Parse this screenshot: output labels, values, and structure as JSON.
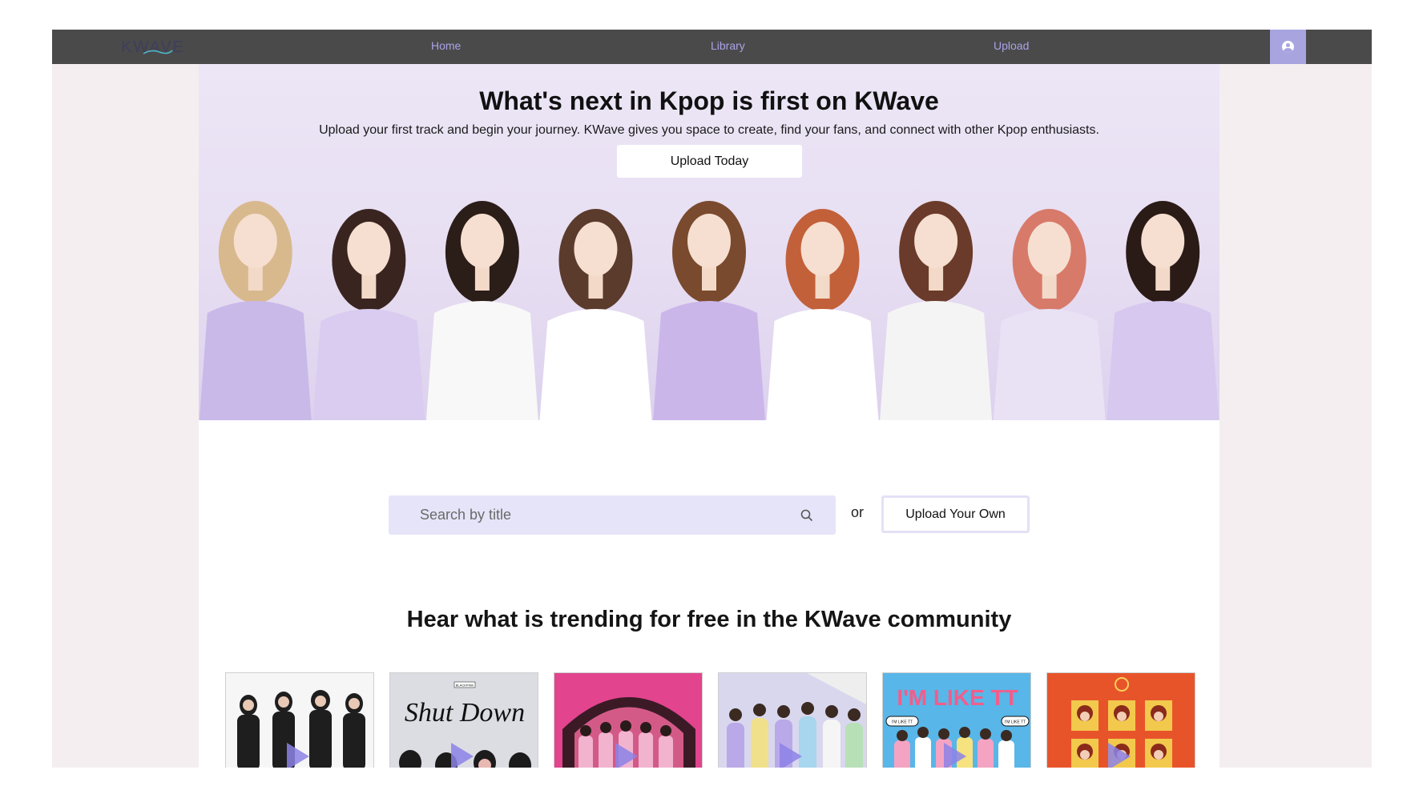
{
  "nav": {
    "logo_text": "KWAVE",
    "links": [
      "Home",
      "Library",
      "Upload"
    ],
    "profile_icon": "user-circle-icon"
  },
  "hero": {
    "title": "What's next in Kpop is first on KWave",
    "subtitle": "Upload your first track and begin your journey. KWave gives you space to create, find your fans, and connect with other Kpop enthusiasts.",
    "button_label": "Upload Today"
  },
  "search": {
    "placeholder": "Search by title",
    "icon": "search-icon",
    "or_text": "or",
    "upload_own_label": "Upload Your Own"
  },
  "trending": {
    "heading": "Hear what is trending for free in the KWave community",
    "card_texts": [
      "BLACKPINK",
      "Shut Down",
      "I'M LIKE TT",
      "I'M LIKE TT",
      "I'M LIKE TT"
    ]
  },
  "colors": {
    "nav_bg": "#4a4a4a",
    "nav_link": "#a9a3e8",
    "accent": "#a7a4e0",
    "search_bg": "#e6e4f8",
    "page_bg": "#f4eef1"
  }
}
